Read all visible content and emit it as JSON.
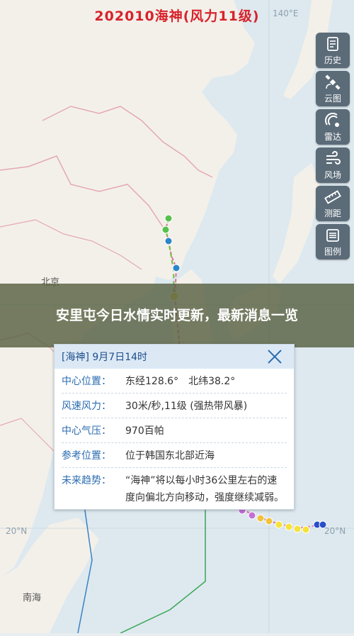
{
  "map": {
    "title": "202010海神(风力11级)",
    "lon_label_top": "140°E",
    "lat_label_left": "20°N",
    "lat_label_right": "20°N",
    "places": {
      "beijing": "北京",
      "south_sea": "南海"
    },
    "colors": {
      "land": "#f3f0ea",
      "sea": "#dde9ef",
      "border": "#e4a8b4",
      "track_past": "#6fc03a",
      "track_forecast": "#f1d33b"
    }
  },
  "sidebar": {
    "items": [
      {
        "label": "历史",
        "icon": "history-icon"
      },
      {
        "label": "云图",
        "icon": "satellite-icon"
      },
      {
        "label": "雷达",
        "icon": "radar-icon"
      },
      {
        "label": "风场",
        "icon": "wind-icon"
      },
      {
        "label": "测距",
        "icon": "ruler-icon"
      },
      {
        "label": "图例",
        "icon": "legend-icon"
      }
    ]
  },
  "headline": {
    "text": "安里屯今日水情实时更新，最新消息一览"
  },
  "popup": {
    "title": "[海神] 9月7日14时",
    "rows": [
      {
        "key": "中心位置：",
        "value": "东经128.6°　北纬38.2°"
      },
      {
        "key": "风速风力：",
        "value": "30米/秒,11级 (强热带风暴)"
      },
      {
        "key": "中心气压：",
        "value": "970百帕"
      },
      {
        "key": "参考位置：",
        "value": "位于韩国东北部近海"
      },
      {
        "key": "未来趋势：",
        "value": "“海神”将以每小时36公里左右的速度向偏北方向移动，强度继续减弱。"
      }
    ]
  }
}
